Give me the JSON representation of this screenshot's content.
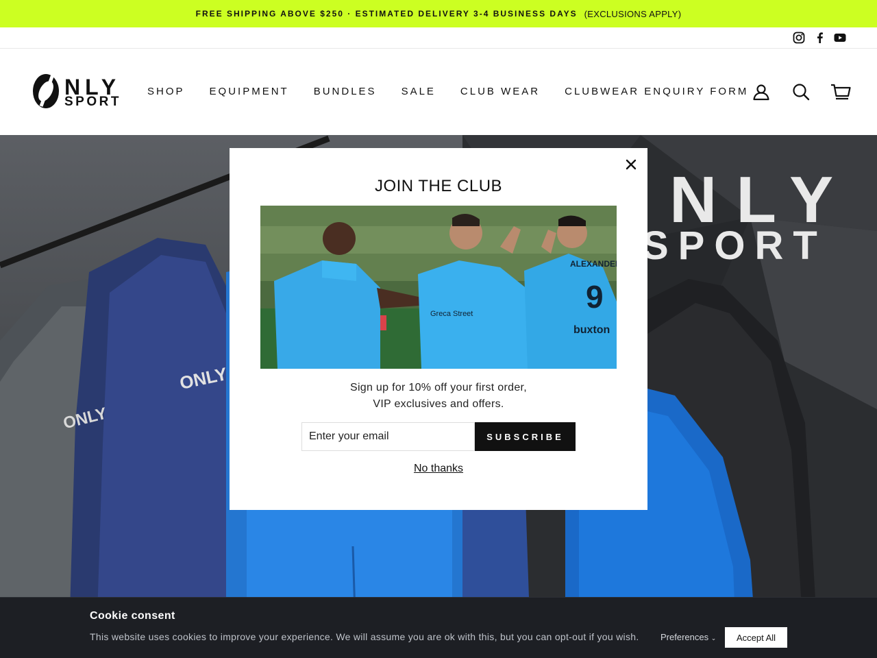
{
  "announcement": {
    "main": "FREE SHIPPING ABOVE $250 · ESTIMATED DELIVERY 3-4 BUSINESS DAYS",
    "sub": "(EXCLUSIONS APPLY)",
    "background": "#ccff22"
  },
  "social": {
    "icons": [
      "instagram-icon",
      "facebook-icon",
      "youtube-icon"
    ]
  },
  "header": {
    "logo_top": "NLY",
    "logo_bottom": "SPORT",
    "nav": [
      "SHOP",
      "EQUIPMENT",
      "BUNDLES",
      "SALE",
      "CLUB WEAR",
      "CLUBWEAR ENQUIRY FORM"
    ],
    "icons": [
      "user-icon",
      "search-icon",
      "cart-icon"
    ]
  },
  "hero": {
    "brand_top": "NLY",
    "brand_bottom": "SPORT"
  },
  "modal": {
    "title": "JOIN THE CLUB",
    "text_line1": "Sign up for 10% off your first order,",
    "text_line2": "VIP exclusives and offers.",
    "email_placeholder": "Enter your email",
    "subscribe_label": "SUBSCRIBE",
    "no_thanks": "No thanks",
    "image_jersey_text": "Greca Street",
    "image_sponsor": "buxton",
    "image_player_name": "ALEXANDER",
    "image_player_number": "9"
  },
  "cookie": {
    "title": "Cookie consent",
    "text": "This website uses cookies to improve your experience. We will assume you are ok with this, but you can opt-out if you wish.",
    "preferences": "Preferences",
    "accept": "Accept All"
  }
}
